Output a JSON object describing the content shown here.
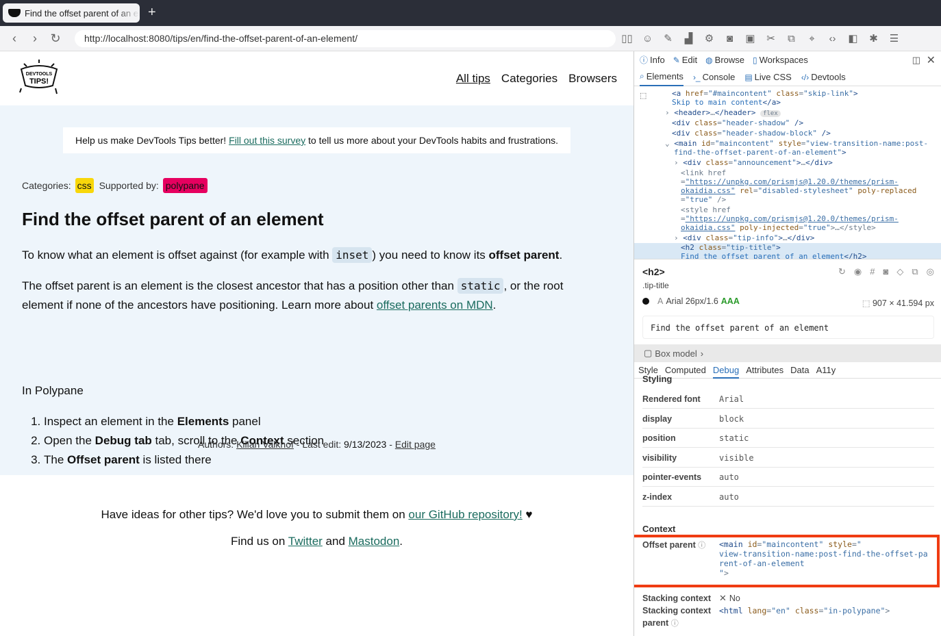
{
  "browser": {
    "tab_title": "Find the offset parent of an element",
    "new_tab": "+",
    "url": "http://localhost:8080/tips/en/find-the-offset-parent-of-an-element/"
  },
  "site": {
    "logo_text": "DEVTOOLS TIPS!",
    "nav": [
      "All tips",
      "Categories",
      "Browsers"
    ]
  },
  "survey": {
    "before": "Help us make DevTools Tips better! ",
    "link": "Fill out this survey",
    "after": " to tell us more about your DevTools habits and frustrations."
  },
  "meta": {
    "categories_label": "Categories:",
    "category": "css",
    "supported_label": "Supported by:",
    "supported": "polypane"
  },
  "article": {
    "title": "Find the offset parent of an element",
    "p1a": "To know what an element is offset against (for example with ",
    "p1code": "inset",
    "p1b": ") you need to know its ",
    "p1bold": "offset parent",
    "p1c": ".",
    "p2a": "The offset parent is an element is the closest ancestor that has a position other than ",
    "p2code": "static",
    "p2b": ", or the root element if none of the ancestors have positioning. Learn more about ",
    "p2link": "offset parents on MDN",
    "p2c": ".",
    "p3": "In Polypane",
    "steps": [
      {
        "a": "Inspect an element in the ",
        "b": "Elements",
        "c": " panel"
      },
      {
        "a": "Open the ",
        "b": "Debug tab",
        "c": " tab, scroll to the ",
        "d": "Context",
        "e": " section"
      },
      {
        "a": "The ",
        "b": "Offset parent",
        "c": " is listed there"
      }
    ]
  },
  "authors": {
    "label": "Authors: ",
    "name": "Kilian Valkhof",
    "edit_label": " - Last edit: ",
    "date": "9/13/2023",
    "sep": " - ",
    "edit_link": "Edit page"
  },
  "footer": {
    "l1a": "Have ideas for other tips? We'd love you to submit them on ",
    "l1link": "our GitHub repository!",
    "l1b": " ♥",
    "l2a": "Find us on ",
    "twitter": "Twitter",
    "and": " and ",
    "mastodon": "Mastodon",
    "dot": "."
  },
  "devtools": {
    "top_tabs": [
      "Info",
      "Edit",
      "Browse",
      "Workspaces"
    ],
    "panel_tabs": [
      "Elements",
      "Console",
      "Live CSS",
      "Devtools"
    ],
    "element": {
      "tag": "<h2>",
      "class": ".tip-title",
      "font": "Arial 26px/1.6",
      "contrast": "AAA",
      "size": "907 × 41.594 px",
      "text": "Find the offset parent of an element"
    },
    "box_model": "Box model",
    "sub_tabs": [
      "Style",
      "Computed",
      "Debug",
      "Attributes",
      "Data",
      "A11y"
    ],
    "styling_label": "Styling",
    "props": [
      [
        "Rendered font",
        "Arial"
      ],
      [
        "display",
        "block"
      ],
      [
        "position",
        "static"
      ],
      [
        "visibility",
        "visible"
      ],
      [
        "pointer-events",
        "auto"
      ],
      [
        "z-index",
        "auto"
      ]
    ],
    "context_label": "Context",
    "offset_parent_label": "Offset parent",
    "stacking_label": "Stacking context",
    "stacking_value": "No",
    "stacking_parent_label": "Stacking context parent"
  }
}
